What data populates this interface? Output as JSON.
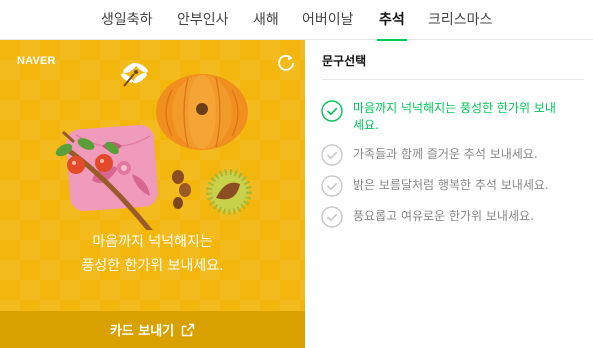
{
  "tabs": [
    {
      "label": "생일축하",
      "active": false
    },
    {
      "label": "안부인사",
      "active": false
    },
    {
      "label": "새해",
      "active": false
    },
    {
      "label": "어버이날",
      "active": false
    },
    {
      "label": "추석",
      "active": true
    },
    {
      "label": "크리스마스",
      "active": false
    }
  ],
  "card": {
    "brand": "NAVER",
    "message_line1": "마음까지 넉넉해지는",
    "message_line2": "풍성한 한가위 보내세요.",
    "send_label": "카드 보내기",
    "background_color": "#f2b60c"
  },
  "phrases": {
    "title": "문구선택",
    "options": [
      {
        "text": "마음까지 넉넉해지는 풍성한 한가위 보내세요.",
        "selected": true
      },
      {
        "text": "가족들과 함께 즐거운 추석 보내세요.",
        "selected": false
      },
      {
        "text": "밝은 보름달처럼 행복한 추석 보내세요.",
        "selected": false
      },
      {
        "text": "풍요롭고 여유로운 한가위 보내세요.",
        "selected": false
      }
    ]
  },
  "colors": {
    "accent": "#03c75a",
    "muted": "#888888",
    "send_bar": "#d8a100"
  }
}
